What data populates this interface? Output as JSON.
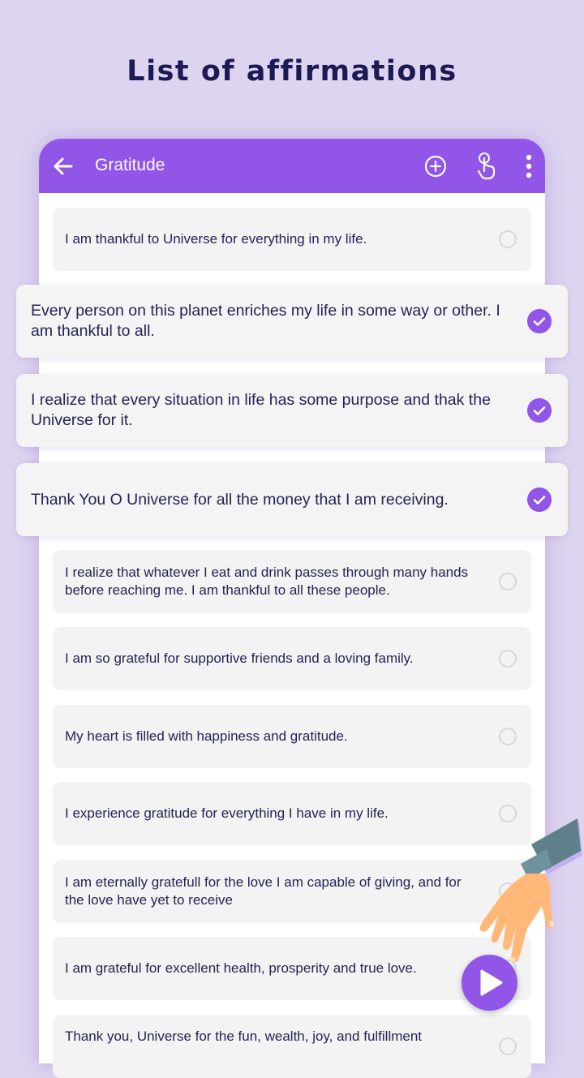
{
  "headline": "List of affirmations",
  "appbar": {
    "title": "Gratitude",
    "icons": [
      "back-arrow-icon",
      "add-circle-icon",
      "touch-gesture-icon",
      "more-vertical-icon"
    ]
  },
  "colors": {
    "accent": "#9155e8",
    "background": "#ddd4f0",
    "text": "#262354",
    "headline": "#1c1a55",
    "card": "#f3f3f3"
  },
  "affirmations": [
    {
      "text": "I am thankful to Universe for everything in my life.",
      "selected": false
    },
    {
      "text": "Every person on this planet enriches my life in some way or other. I am thankful to all.",
      "selected": true
    },
    {
      "text": "I realize that every situation in life has some purpose and thak the Universe for it.",
      "selected": true
    },
    {
      "text": "Thank You O Universe for all the money that I am receiving.",
      "selected": true
    },
    {
      "text": "I realize that whatever I eat and drink passes through many hands before reaching me. I am thankful to all these people.",
      "selected": false
    },
    {
      "text": "I am so grateful for supportive friends and a loving family.",
      "selected": false
    },
    {
      "text": "My heart is filled with happiness and gratitude.",
      "selected": false
    },
    {
      "text": "I experience gratitude for everything I have in my life.",
      "selected": false
    },
    {
      "text": "I am eternally gratefull for the love I am capable of giving, and for the love have yet to receive",
      "selected": false
    },
    {
      "text": "I am grateful for excellent health, prosperity and true love.",
      "selected": false
    },
    {
      "text": "Thank you, Universe for the fun, wealth, joy, and fulfillment",
      "selected": false
    }
  ],
  "fab": {
    "icon": "play-icon"
  }
}
